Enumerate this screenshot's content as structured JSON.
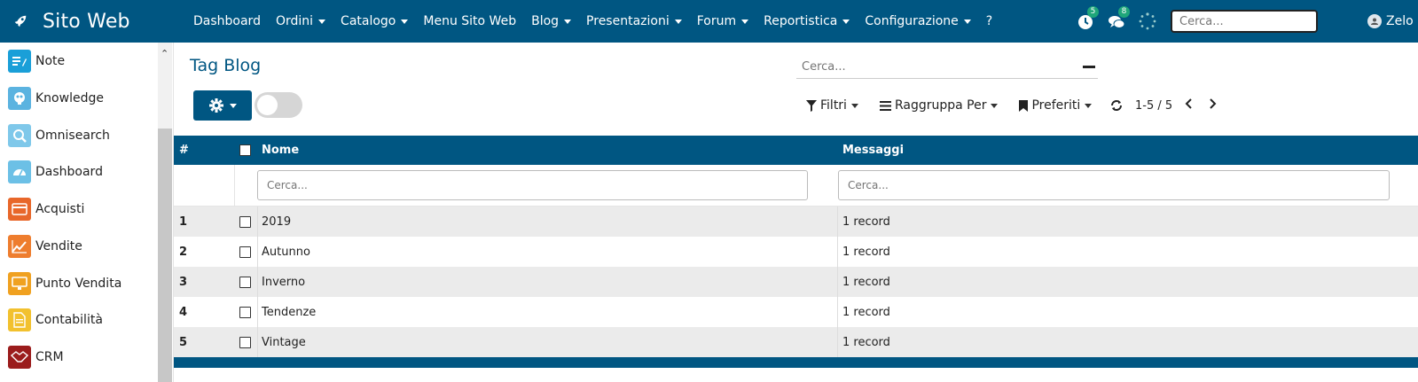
{
  "app": {
    "title": "Sito Web",
    "user": "Zelo"
  },
  "menu": [
    {
      "label": "Dashboard",
      "caret": false
    },
    {
      "label": "Ordini",
      "caret": true
    },
    {
      "label": "Catalogo",
      "caret": true
    },
    {
      "label": "Menu Sito Web",
      "caret": false
    },
    {
      "label": "Blog",
      "caret": true
    },
    {
      "label": "Presentazioni",
      "caret": true
    },
    {
      "label": "Forum",
      "caret": true
    },
    {
      "label": "Reportistica",
      "caret": true
    },
    {
      "label": "Configurazione",
      "caret": true
    },
    {
      "label": "?",
      "caret": false
    }
  ],
  "badges": {
    "activities": "5",
    "messages": "8"
  },
  "top_search_placeholder": "Cerca...",
  "sidebar": {
    "items": [
      {
        "label": "Note",
        "icon": "note-icon",
        "color": "#1a9fd8"
      },
      {
        "label": "Knowledge",
        "icon": "knowledge-icon",
        "color": "#5bb3e0"
      },
      {
        "label": "Omnisearch",
        "icon": "omnisearch-icon",
        "color": "#7fc8ea"
      },
      {
        "label": "Dashboard",
        "icon": "dashboard-icon",
        "color": "#6cc0e6"
      },
      {
        "label": "Acquisti",
        "icon": "purchase-icon",
        "color": "#e8672a"
      },
      {
        "label": "Vendite",
        "icon": "sales-icon",
        "color": "#ee7d2e"
      },
      {
        "label": "Punto Vendita",
        "icon": "pos-icon",
        "color": "#f0a120"
      },
      {
        "label": "Contabilità",
        "icon": "accounting-icon",
        "color": "#f2c12e"
      },
      {
        "label": "CRM",
        "icon": "crm-icon",
        "color": "#9b1c1c"
      }
    ]
  },
  "control_panel": {
    "title": "Tag Blog",
    "search_placeholder": "Cerca...",
    "filters_label": "Filtri",
    "groupby_label": "Raggruppa Per",
    "favorites_label": "Preferiti",
    "pager": "1-5 / 5"
  },
  "table": {
    "headers": {
      "index": "#",
      "name": "Nome",
      "messages": "Messaggi"
    },
    "filter_placeholder": "Cerca...",
    "rows": [
      {
        "index": "1",
        "name": "2019",
        "messages": "1 record"
      },
      {
        "index": "2",
        "name": "Autunno",
        "messages": "1 record"
      },
      {
        "index": "3",
        "name": "Inverno",
        "messages": "1 record"
      },
      {
        "index": "4",
        "name": "Tendenze",
        "messages": "1 record"
      },
      {
        "index": "5",
        "name": "Vintage",
        "messages": "1 record"
      }
    ]
  },
  "colors": {
    "brand": "#005682",
    "row_alt": "#ebebeb",
    "badge": "#1fa67a"
  }
}
